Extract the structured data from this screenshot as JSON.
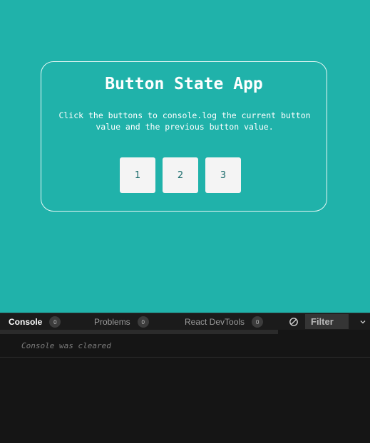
{
  "preview": {
    "title": "Button State App",
    "description": "Click the buttons to console.log the current button value and the previous button value.",
    "buttons": [
      "1",
      "2",
      "3"
    ]
  },
  "console_panel": {
    "tabs": [
      {
        "label": "Console",
        "count": "0"
      },
      {
        "label": "Problems",
        "count": "0"
      },
      {
        "label": "React DevTools",
        "count": "0"
      }
    ],
    "filter_placeholder": "Filter",
    "clear_icon": "clear-console-icon",
    "expand_icon": "chevron-down-icon",
    "messages": [
      "Console was cleared"
    ]
  },
  "colors": {
    "preview_background": "#20b2aa",
    "button_background": "#f4f4f4",
    "console_background": "#151515"
  }
}
